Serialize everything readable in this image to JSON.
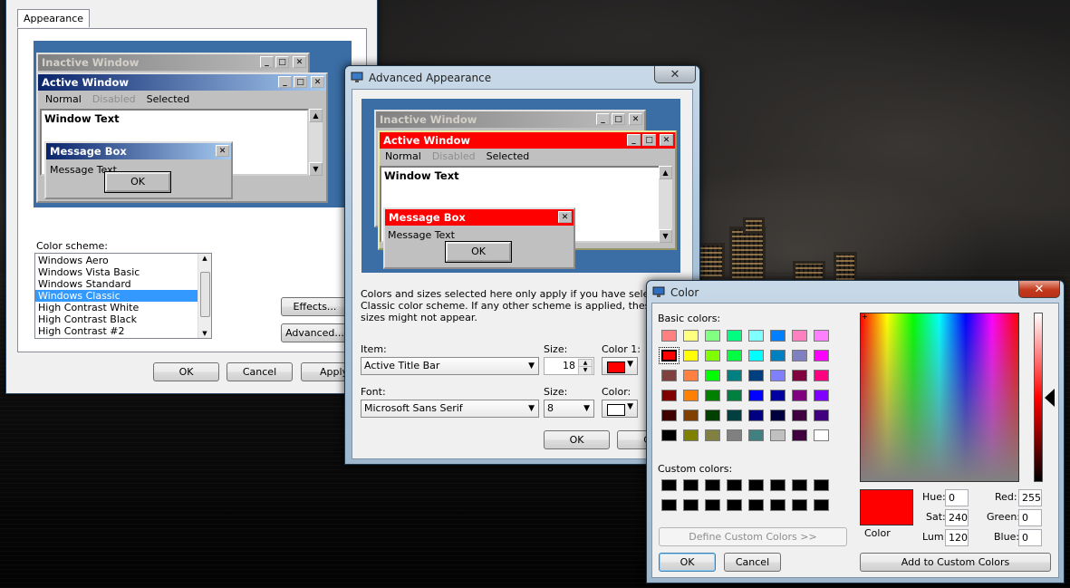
{
  "appearance": {
    "tab": "Appearance",
    "preview": {
      "inactive_title": "Inactive Window",
      "active_title": "Active Window",
      "menu": [
        "Normal",
        "Disabled",
        "Selected"
      ],
      "window_text": "Window Text",
      "msgbox_title": "Message Box",
      "msgbox_text": "Message Text",
      "ok": "OK"
    },
    "scheme_label": "Color scheme:",
    "schemes": [
      "Windows Aero",
      "Windows Vista Basic",
      "Windows Standard",
      "Windows Classic",
      "High Contrast White",
      "High Contrast Black",
      "High Contrast #2"
    ],
    "selected_scheme": "Windows Classic",
    "effects": "Effects...",
    "advanced": "Advanced...",
    "ok": "OK",
    "cancel": "Cancel",
    "apply": "Apply"
  },
  "advanced": {
    "title": "Advanced Appearance",
    "preview": {
      "inactive_title": "Inactive Window",
      "active_title": "Active Window",
      "menu": [
        "Normal",
        "Disabled",
        "Selected"
      ],
      "window_text": "Window Text",
      "msgbox_title": "Message Box",
      "msgbox_text": "Message Text",
      "ok": "OK"
    },
    "info_line1": "Colors and sizes selected here only apply if you have selected a W",
    "info_line2": "Classic color scheme. If any other scheme is applied, these colors",
    "info_line3": "sizes might not appear.",
    "item_label": "Item:",
    "item_value": "Active Title Bar",
    "size_label": "Size:",
    "size_value": "18",
    "color1_label": "Color 1:",
    "font_label": "Font:",
    "font_value": "Microsoft Sans Serif",
    "font_size_label": "Size:",
    "font_size_value": "8",
    "font_color_label": "Color:",
    "ok": "OK",
    "cancel": "Ca"
  },
  "color_dialog": {
    "title": "Color",
    "basic_label": "Basic colors:",
    "basic_colors": [
      "#ff8080",
      "#ffff80",
      "#80ff80",
      "#00ff80",
      "#80ffff",
      "#0080ff",
      "#ff80c0",
      "#ff80ff",
      "#ff0000",
      "#ffff00",
      "#80ff00",
      "#00ff40",
      "#00ffff",
      "#0080c0",
      "#8080c0",
      "#ff00ff",
      "#804040",
      "#ff8040",
      "#00ff00",
      "#008080",
      "#004080",
      "#8080ff",
      "#800040",
      "#ff0080",
      "#800000",
      "#ff8000",
      "#008000",
      "#008040",
      "#0000ff",
      "#0000a0",
      "#800080",
      "#8000ff",
      "#400000",
      "#804000",
      "#004000",
      "#004040",
      "#000080",
      "#000040",
      "#400040",
      "#400080",
      "#000000",
      "#808000",
      "#808040",
      "#808080",
      "#408080",
      "#c0c0c0",
      "#400040",
      "#ffffff"
    ],
    "selected_index": 8,
    "custom_label": "Custom colors:",
    "define_custom": "Define Custom Colors >>",
    "ok": "OK",
    "cancel": "Cancel",
    "color_label": "Color",
    "hue_label": "Hue:",
    "hue": "0",
    "sat_label": "Sat:",
    "sat": "240",
    "lum_label": "Lum:",
    "lum": "120",
    "red_label": "Red:",
    "red": "255",
    "green_label": "Green:",
    "green": "0",
    "blue_label": "Blue:",
    "blue": "0",
    "add_custom": "Add to Custom Colors",
    "current_color": "#ff0000"
  },
  "colors": {
    "classic_active": "#0a246a",
    "red_title": "#ff0000",
    "desktop_blue": "#3a6ea5",
    "selection": "#3399ff"
  }
}
